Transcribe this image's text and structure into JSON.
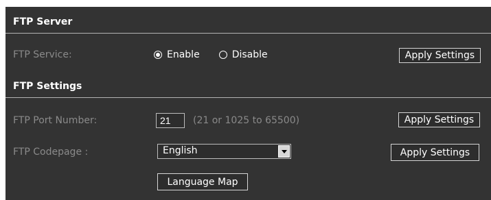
{
  "ftp_server": {
    "title": "FTP Server",
    "service_label": "FTP Service:",
    "options": [
      {
        "label": "Enable",
        "selected": true
      },
      {
        "label": "Disable",
        "selected": false
      }
    ],
    "apply_label": "Apply Settings"
  },
  "ftp_settings": {
    "title": "FTP Settings",
    "port_label": "FTP Port Number:",
    "port_value": "21",
    "port_hint": "(21 or 1025 to 65500)",
    "port_apply_label": "Apply Settings",
    "codepage_label": "FTP Codepage :",
    "codepage_value": "English",
    "codepage_apply_label": "Apply Settings",
    "language_map_label": "Language Map"
  },
  "colors": {
    "panel_bg": "#333333",
    "divider": "#b5b5b5",
    "label_text": "#8a8a8a",
    "value_text": "#ffffff"
  },
  "icons": {
    "dropdown": "chevron-down-icon",
    "radio_selected": "radio-checked-icon",
    "radio_unselected": "radio-unchecked-icon"
  }
}
